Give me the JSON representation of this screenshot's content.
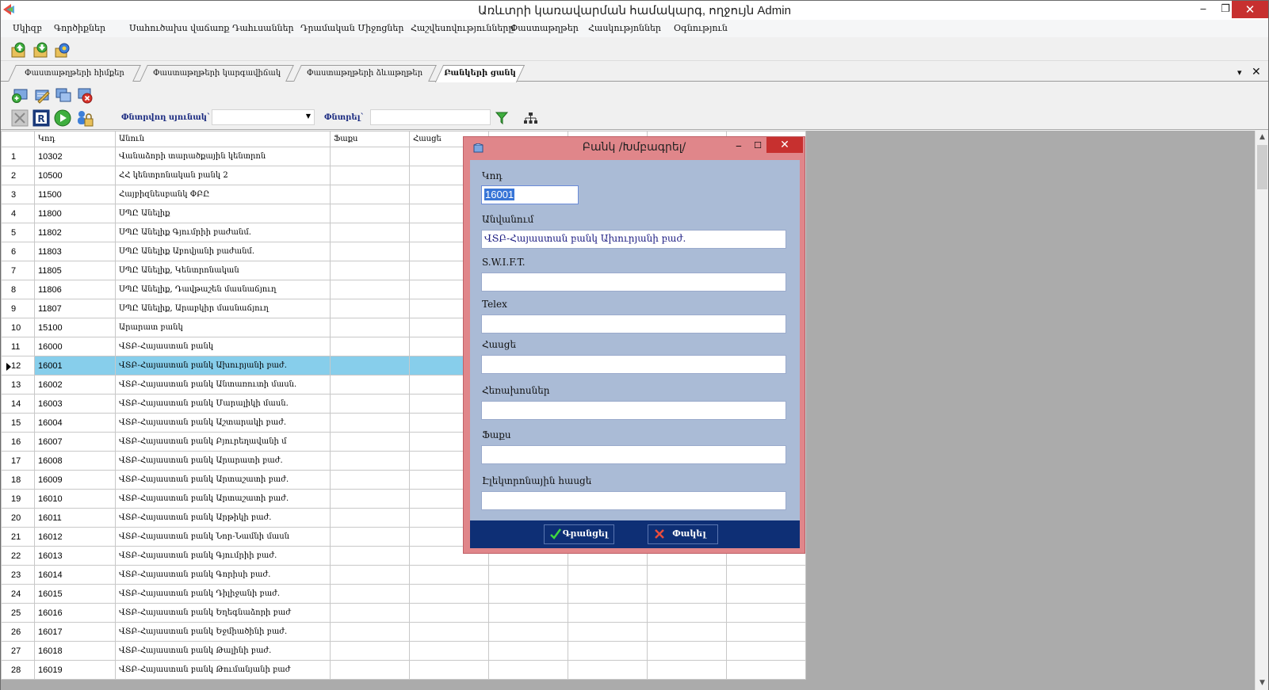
{
  "window": {
    "title": "Առևտրի կառավարման համակարգ, ողջույն Admin",
    "minimize": "‒",
    "restore": "❐",
    "close": "✕"
  },
  "menu": [
    "Սկիզբ",
    "Գործիքներ",
    "Սահուծախս վաճառք",
    "Դահւսաններ",
    "Դրամական Միջոցներ",
    "Հաշվեսովությունները",
    "Փաստաթղթեր",
    "Հասկությոններ",
    "Օգնություն"
  ],
  "tabs": [
    {
      "label": "Փաստաթղթերի հիմքեր",
      "active": false
    },
    {
      "label": "Փաստաթղթերի կարգավիճակ",
      "active": false
    },
    {
      "label": "Փաստաթղթերի ձևաթղթեր",
      "active": false
    },
    {
      "label": "Բանկերի ցանկ",
      "active": true
    }
  ],
  "tabs_controls": {
    "dropdown": "▾",
    "close": "✕"
  },
  "filter": {
    "column_label": "Փնտրվող սյունակ`",
    "search_label": "Փնտրել`",
    "column_value": "",
    "search_value": ""
  },
  "grid": {
    "columns": [
      "Կոդ",
      "Անուն",
      "Ֆաքս",
      "Հասցե"
    ],
    "selected_row": 12,
    "rows": [
      {
        "n": "1",
        "code": "10302",
        "name": "Վանաձորի տարածքային կենտրոն"
      },
      {
        "n": "2",
        "code": "10500",
        "name": "ՀՀ կենտրոնական բանկ 2"
      },
      {
        "n": "3",
        "code": "11500",
        "name": "Հայբիզնեսբանկ ՓԲԸ"
      },
      {
        "n": "4",
        "code": "11800",
        "name": "ՍՊԸ Անելիք"
      },
      {
        "n": "5",
        "code": "11802",
        "name": "ՍՊԸ Անելիք Գյումրիի բաժանմ."
      },
      {
        "n": "6",
        "code": "11803",
        "name": "ՍՊԸ Անելիք Աբովյանի բաժանմ."
      },
      {
        "n": "7",
        "code": "11805",
        "name": "ՍՊԸ Անելիք, Կենտրոնական"
      },
      {
        "n": "8",
        "code": "11806",
        "name": "ՍՊԸ Անելիք, Դավթաշեն մասնաճյուղ"
      },
      {
        "n": "9",
        "code": "11807",
        "name": "ՍՊԸ Անելիք, Արաբկիր մասնաճյուղ"
      },
      {
        "n": "10",
        "code": "15100",
        "name": "Արարատ բանկ"
      },
      {
        "n": "11",
        "code": "16000",
        "name": "ՎՏԲ-Հայաստան բանկ"
      },
      {
        "n": "12",
        "code": "16001",
        "name": "ՎՏԲ-Հայաստան բանկ Ախուրյանի բաժ."
      },
      {
        "n": "13",
        "code": "16002",
        "name": "ՎՏԲ-Հայաստան բանկ Անտառուտի մասն."
      },
      {
        "n": "14",
        "code": "16003",
        "name": "ՎՏԲ-Հայաստան բանկ Մարալիկի մասն."
      },
      {
        "n": "15",
        "code": "16004",
        "name": "ՎՏԲ-Հայաստան բանկ Աշտարակի բաժ."
      },
      {
        "n": "16",
        "code": "16007",
        "name": "ՎՏԲ-Հայաստան բանկ Բյուրեղավանի մ"
      },
      {
        "n": "17",
        "code": "16008",
        "name": "ՎՏԲ-Հայաստան բանկ Արարատի բաժ."
      },
      {
        "n": "18",
        "code": "16009",
        "name": "ՎՏԲ-Հայաստան բանկ Արտաշատի բաժ."
      },
      {
        "n": "19",
        "code": "16010",
        "name": "ՎՏԲ-Հայաստան բանկ Արտաշատի բաժ."
      },
      {
        "n": "20",
        "code": "16011",
        "name": "ՎՏԲ-Հայաստան բանկ Արթիկի բաժ."
      },
      {
        "n": "21",
        "code": "16012",
        "name": "ՎՏԲ-Հայաստան բանկ Նոր-Նամնի մասն"
      },
      {
        "n": "22",
        "code": "16013",
        "name": "ՎՏԲ-Հայաստան բանկ Գյումրիի բաժ."
      },
      {
        "n": "23",
        "code": "16014",
        "name": "ՎՏԲ-Հայաստան բանկ Գորիսի բաժ."
      },
      {
        "n": "24",
        "code": "16015",
        "name": "ՎՏԲ-Հայաստան բանկ Դիլիջանի բաժ."
      },
      {
        "n": "25",
        "code": "16016",
        "name": "ՎՏԲ-Հայաստան բանկ Եղեգնաձորի բաժ"
      },
      {
        "n": "26",
        "code": "16017",
        "name": "ՎՏԲ-Հայաստան բանկ Եջմիածինի բաժ."
      },
      {
        "n": "27",
        "code": "16018",
        "name": "ՎՏԲ-Հայաստան բանկ Թալինի բաժ."
      },
      {
        "n": "28",
        "code": "16019",
        "name": "ՎՏԲ-Հայաստան բանկ Թումանյանի բաժ"
      }
    ]
  },
  "dialog": {
    "title": "Բանկ /Խմբագրել/",
    "minimize": "‒",
    "maximize": "☐",
    "close": "✕",
    "fields": {
      "code": {
        "label": "Կոդ",
        "value": "16001"
      },
      "name": {
        "label": "Անվանում",
        "value": "ՎՏԲ-Հայաստան բանկ Ախուրյանի բաժ."
      },
      "swift": {
        "label": "S.W.I.F.T.",
        "value": ""
      },
      "telex": {
        "label": "Telex",
        "value": ""
      },
      "address": {
        "label": "Հասցե",
        "value": ""
      },
      "phones": {
        "label": "Հեռախոսներ",
        "value": ""
      },
      "fax": {
        "label": "Ֆաքս",
        "value": ""
      },
      "email": {
        "label": "Էլեկտրոնային հասցե",
        "value": ""
      }
    },
    "save_label": "Գրանցել",
    "close_label": "Փակել"
  },
  "colors": {
    "selection": "#87ceeb",
    "dialog_frame": "#e0868a",
    "dialog_body": "#aabbd6",
    "dialog_footer": "#0e2f75",
    "close_red": "#c7302f"
  }
}
